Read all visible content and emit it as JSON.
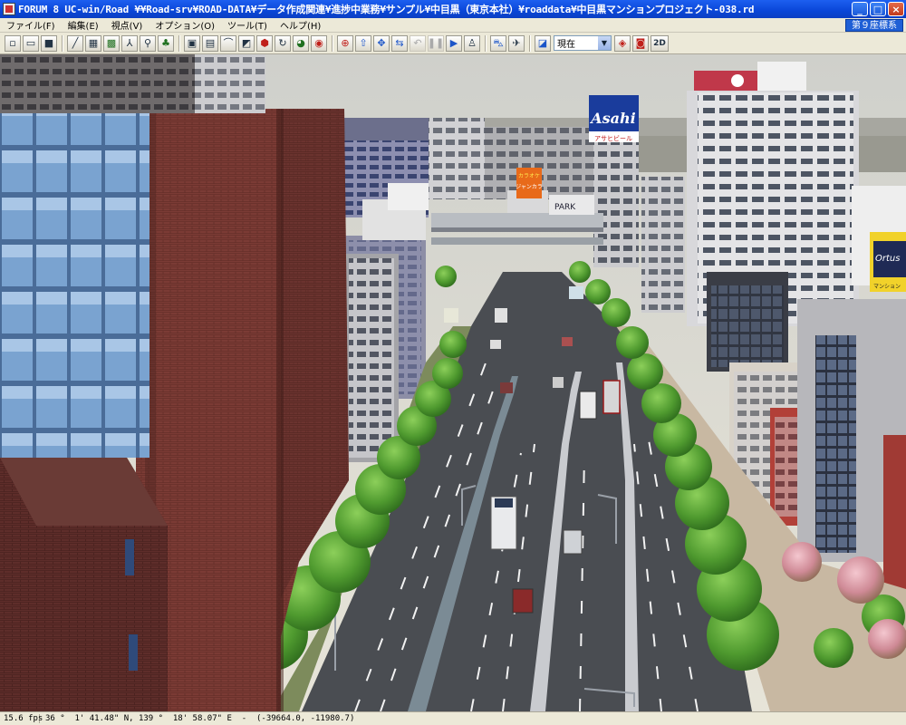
{
  "window": {
    "title": "FORUM 8   UC-win/Road   ¥¥Road-srv¥ROAD-DATA¥データ作成関連¥進捗中業務¥サンプル¥中目黒（東京本社）¥roaddata¥中目黒マンションプロジェクト-038.rd",
    "minimize_label": "_",
    "maximize_label": "□",
    "close_label": "×"
  },
  "menu": {
    "items": [
      "ファイル(F)",
      "編集(E)",
      "視点(V)",
      "オプション(O)",
      "ツール(T)",
      "ヘルプ(H)"
    ],
    "coordinate_system": "第９座標系"
  },
  "toolbar": {
    "view_select_value": "現在",
    "mode_2d_label": "2D"
  },
  "scene": {
    "billboards": {
      "asahi_main": "Asahi",
      "asahi_sub": "アサヒビール",
      "karaoke_line1": "カラオケ",
      "karaoke_line2": "ジャンカラ",
      "right_sign": "Ortus",
      "right_sign_sub": "マンション",
      "park_sign": "PARK"
    }
  },
  "status": {
    "fps": "15.6 fps",
    "coordinates": "36 °  1' 41.48\" N, 139 °  18' 58.07\" E  -  (-39664.0, -11980.7)"
  }
}
